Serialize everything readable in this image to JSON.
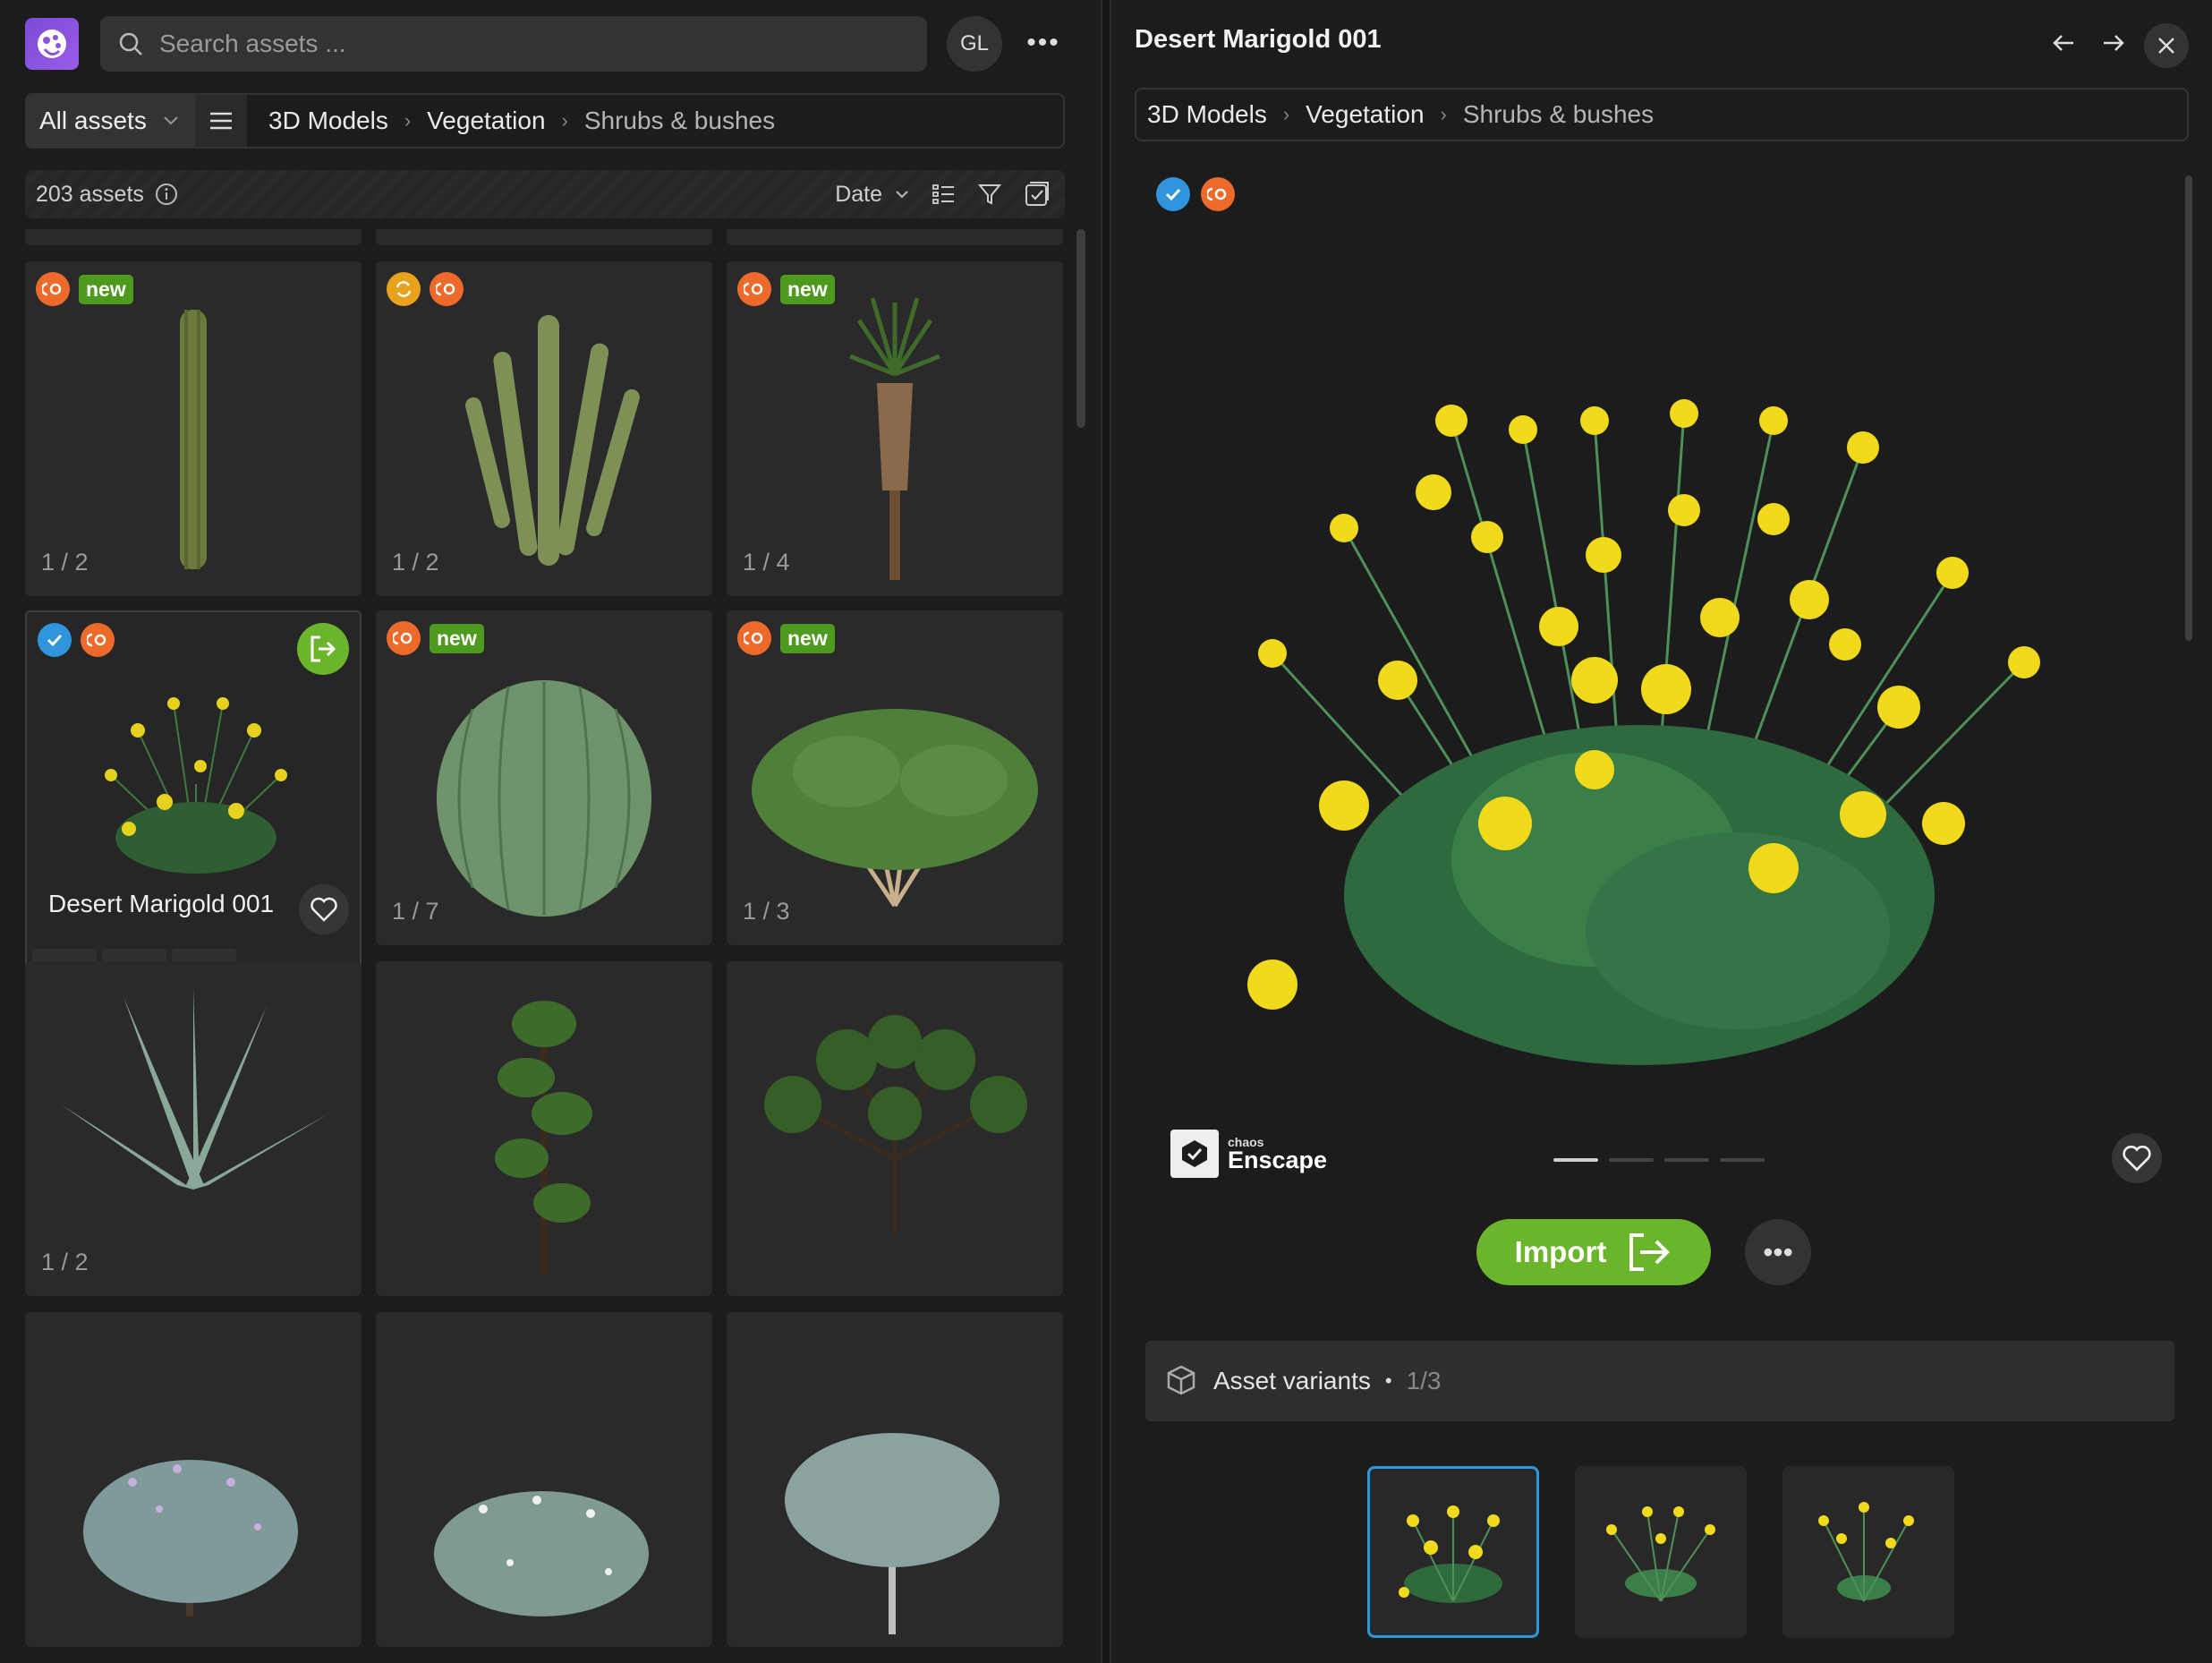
{
  "colors": {
    "accent_green": "#6bb52c",
    "badge_green": "#4d9a1f",
    "enscape_orange": "#ee6a2a",
    "check_blue": "#2f95dc",
    "sync_yellow": "#e8a21c",
    "brand_purple": "#8a52e0"
  },
  "header": {
    "search_placeholder": "Search assets ...",
    "avatar_initials": "GL",
    "more_label": "•••"
  },
  "nav": {
    "filter_label": "All assets",
    "breadcrumb": [
      "3D Models",
      "Vegetation",
      "Shrubs & bushes"
    ]
  },
  "status": {
    "count_label": "203 assets",
    "sort_label": "Date"
  },
  "grid": {
    "cards": [
      {
        "new": true,
        "sync": false,
        "check": false,
        "count": "1 / 2"
      },
      {
        "new": false,
        "sync": true,
        "check": false,
        "count": "1 / 2"
      },
      {
        "new": true,
        "sync": false,
        "check": false,
        "count": "1 / 4"
      },
      {
        "new": false,
        "sync": false,
        "check": true,
        "title": "Desert Marigold 001",
        "selected": true
      },
      {
        "new": true,
        "sync": false,
        "check": false,
        "count": "1 / 7"
      },
      {
        "new": true,
        "sync": false,
        "check": false,
        "count": "1 / 3"
      },
      {
        "count": "1 / 2"
      },
      {
        "count": ""
      },
      {
        "count": ""
      },
      {
        "count": ""
      },
      {
        "count": ""
      },
      {
        "count": ""
      }
    ],
    "new_label": "new"
  },
  "detail": {
    "title": "Desert Marigold 001",
    "breadcrumb": [
      "3D Models",
      "Vegetation",
      "Shrubs & bushes"
    ],
    "brand_small": "chaos",
    "brand_big": "Enscape",
    "import_label": "Import",
    "more_label": "•••",
    "variants_label": "Asset variants",
    "variants_count": "1/3",
    "image_index": 1,
    "image_total": 4
  }
}
